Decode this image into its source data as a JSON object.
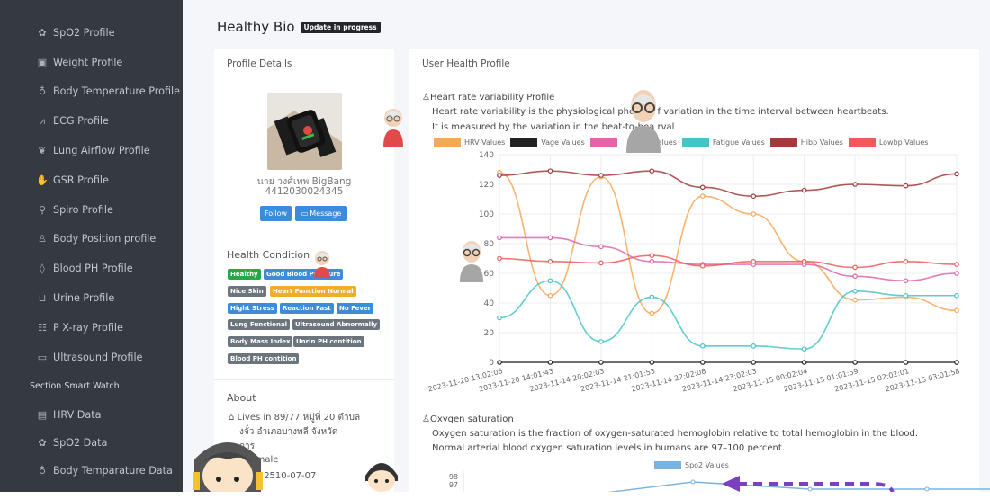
{
  "sidebar": {
    "items": [
      {
        "label": "SpO2 Profile",
        "icon": "lungs-icon"
      },
      {
        "label": "Weight Profile",
        "icon": "weight-icon"
      },
      {
        "label": "Body Temperature Profile",
        "icon": "thermometer-icon"
      },
      {
        "label": "ECG Profile",
        "icon": "heartbeat-icon"
      },
      {
        "label": "Lung Airflow Profile",
        "icon": "lungs-icon"
      },
      {
        "label": "GSR Profile",
        "icon": "hand-icon"
      },
      {
        "label": "Spiro Profile",
        "icon": "spirometer-icon"
      },
      {
        "label": "Body Position profile",
        "icon": "body-icon"
      },
      {
        "label": "Blood PH Profile",
        "icon": "drop-icon"
      },
      {
        "label": "Urine Profile",
        "icon": "toilet-icon"
      },
      {
        "label": "P X-ray Profile",
        "icon": "xray-icon"
      },
      {
        "label": "Ultrasound Profile",
        "icon": "monitor-icon"
      }
    ],
    "section_header": "Section Smart Watch",
    "watch_items": [
      {
        "label": "HRV Data",
        "icon": "chart-icon"
      },
      {
        "label": "SpO2 Data",
        "icon": "lungs-icon"
      },
      {
        "label": "Body Temparature Data",
        "icon": "thermometer-icon"
      }
    ]
  },
  "page": {
    "title": "Healthy Bio",
    "badge": "Update in progress"
  },
  "profile": {
    "title": "Profile Details",
    "name": "นาย วงศ์เทพ BigBang",
    "id": "4412030024345",
    "follow": "Follow",
    "message": "Message"
  },
  "health": {
    "title": "Health Condition",
    "tags": [
      {
        "label": "Healthy",
        "color": "#28a745"
      },
      {
        "label": "Good Blood Pressure",
        "color": "#3d8bd9"
      },
      {
        "label": "Nice Skin",
        "color": "#6c757d"
      },
      {
        "label": "Heart Function Normal",
        "color": "#f0ad2a"
      },
      {
        "label": "Hight Stress",
        "color": "#3d8bd9"
      },
      {
        "label": "Reaction Fast",
        "color": "#3d8bd9"
      },
      {
        "label": "No Fever",
        "color": "#3d8bd9"
      },
      {
        "label": "Lung Functional",
        "color": "#6c757d"
      },
      {
        "label": "Ultrasound Abnormally",
        "color": "#6c757d"
      },
      {
        "label": "Body Mass Index",
        "color": "#6c757d"
      },
      {
        "label": "Unrin PH contition",
        "color": "#6c757d"
      },
      {
        "label": "Blood PH contition",
        "color": "#6c757d"
      }
    ]
  },
  "about": {
    "title": "About",
    "line1": "Lives in 89/77 หมู่ที่ 20 ตำบล",
    "line2": "งจั่ว อำเภอบางพลี จังหวัด",
    "line3": "การ",
    "line4": "r Female",
    "line5": "Birth 2510-07-07"
  },
  "right": {
    "title": "User Health Profile",
    "hrv_title": "Heart rate variability Profile",
    "hrv_desc1": "Heart rate variability is the physiological phenom          f variation in the time interval between heartbeats.",
    "hrv_desc2": "It is measured by the variation in the beat-to-bea          rval",
    "oxy_title": "Oxygen saturation",
    "oxy_desc1": "Oxygen saturation is the fraction of oxygen-saturated hemoglobin relative to total hemoglobin in the blood.",
    "oxy_desc2": "Normal arterial blood oxygen saturation levels in humans are 97–100 percent."
  },
  "chart_data": [
    {
      "type": "line",
      "x": [
        "2023-11-20 13:02:06",
        "2023-11-20 14:01:43",
        "2023-11-14 20:02:03",
        "2023-11-14 21:01:53",
        "2023-11-14 22:02:08",
        "2023-11-14 23:02:03",
        "2023-11-15 00:02:04",
        "2023-11-15 01:01:59",
        "2023-11-15 02:02:01",
        "2023-11-15 03:01:58"
      ],
      "ylim": [
        0,
        140
      ],
      "yticks": [
        0,
        20,
        40,
        60,
        80,
        100,
        120,
        140
      ],
      "series": [
        {
          "name": "HRV Values",
          "color": "#f6a75a",
          "values": [
            128,
            45,
            125,
            33,
            112,
            100,
            68,
            42,
            44,
            35
          ]
        },
        {
          "name": "Vage Values",
          "color": "#222222",
          "values": [
            0,
            0,
            0,
            0,
            0,
            0,
            0,
            0,
            0,
            0
          ]
        },
        {
          "name": "",
          "color": "#e066a8",
          "values": [
            84,
            84,
            78,
            68,
            66,
            66,
            66,
            58,
            55,
            60
          ]
        },
        {
          "name": "Values",
          "color": "#999999",
          "values": [
            null,
            null,
            null,
            null,
            null,
            null,
            null,
            null,
            null,
            null
          ]
        },
        {
          "name": "Fatigue Values",
          "color": "#45c4c8",
          "values": [
            30,
            55,
            14,
            44,
            11,
            11,
            9,
            48,
            45,
            45
          ]
        },
        {
          "name": "Hibp Values",
          "color": "#a23b3b",
          "values": [
            126,
            129,
            126,
            129,
            118,
            112,
            116,
            120,
            119,
            127
          ]
        },
        {
          "name": "Lowbp Values",
          "color": "#f05a5a",
          "values": [
            70,
            68,
            67,
            72,
            65,
            68,
            68,
            64,
            68,
            66
          ]
        }
      ]
    },
    {
      "type": "line",
      "series": [
        {
          "name": "Spo2 Values",
          "color": "#7ab3e0",
          "values": [
            96,
            98,
            97,
            97,
            97
          ]
        }
      ],
      "yticks": [
        98,
        97
      ]
    }
  ]
}
